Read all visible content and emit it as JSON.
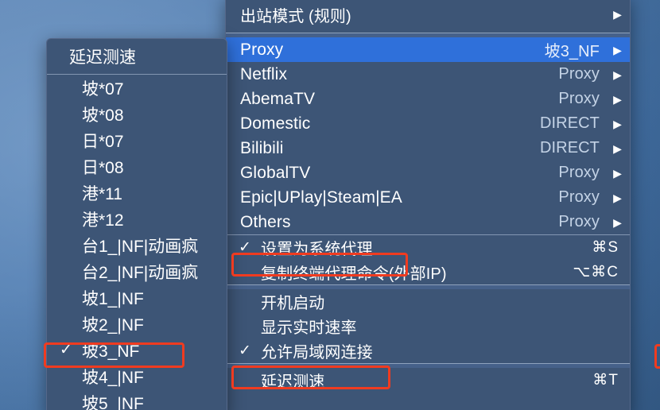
{
  "app": {
    "kind": "macos-menubar-dropdown",
    "accent_selected": "#2f70da",
    "menu_background": "#3d5576",
    "annotation_color": "#f03b20"
  },
  "main_menu": {
    "header": {
      "label": "出站模式 (规则)",
      "arrow": "▶"
    },
    "proxy_groups": [
      {
        "label": "Proxy",
        "value": "坡3_NF",
        "arrow": "▶",
        "selected": true
      },
      {
        "label": "Netflix",
        "value": "Proxy",
        "arrow": "▶",
        "selected": false
      },
      {
        "label": "AbemaTV",
        "value": "Proxy",
        "arrow": "▶",
        "selected": false
      },
      {
        "label": "Domestic",
        "value": "DIRECT",
        "arrow": "▶",
        "selected": false
      },
      {
        "label": "Bilibili",
        "value": "DIRECT",
        "arrow": "▶",
        "selected": false
      },
      {
        "label": "GlobalTV",
        "value": "Proxy",
        "arrow": "▶",
        "selected": false
      },
      {
        "label": "Epic|UPlay|Steam|EA",
        "value": "Proxy",
        "arrow": "▶",
        "selected": false
      },
      {
        "label": "Others",
        "value": "Proxy",
        "arrow": "▶",
        "selected": false
      }
    ],
    "system_items": [
      {
        "label": "设置为系统代理",
        "shortcut": "⌘S",
        "checked": true,
        "check": "✓",
        "annotated": true
      },
      {
        "label": "复制终端代理命令(外部IP)",
        "shortcut": "⌥⌘C",
        "checked": false,
        "check": "",
        "annotated": false
      }
    ],
    "option_items": [
      {
        "label": "开机启动",
        "shortcut": "",
        "checked": false,
        "check": "",
        "annotated": false
      },
      {
        "label": "显示实时速率",
        "shortcut": "",
        "checked": false,
        "check": "",
        "annotated": false
      },
      {
        "label": "允许局域网连接",
        "shortcut": "",
        "checked": true,
        "check": "✓",
        "annotated": true
      }
    ],
    "footer_items": [
      {
        "label": "延迟测速",
        "shortcut": "⌘T",
        "checked": false,
        "check": "",
        "annotated": false
      }
    ]
  },
  "sub_menu": {
    "title": "延迟测速",
    "items": [
      {
        "label": "坡*07",
        "checked": false,
        "check": "",
        "annotated": false
      },
      {
        "label": "坡*08",
        "checked": false,
        "check": "",
        "annotated": false
      },
      {
        "label": "日*07",
        "checked": false,
        "check": "",
        "annotated": false
      },
      {
        "label": "日*08",
        "checked": false,
        "check": "",
        "annotated": false
      },
      {
        "label": "港*11",
        "checked": false,
        "check": "",
        "annotated": false
      },
      {
        "label": "港*12",
        "checked": false,
        "check": "",
        "annotated": false
      },
      {
        "label": "台1_|NF|动画疯",
        "checked": false,
        "check": "",
        "annotated": false
      },
      {
        "label": "台2_|NF|动画疯",
        "checked": false,
        "check": "",
        "annotated": false
      },
      {
        "label": "坡1_|NF",
        "checked": false,
        "check": "",
        "annotated": false
      },
      {
        "label": "坡2_|NF",
        "checked": false,
        "check": "",
        "annotated": false
      },
      {
        "label": "坡3_NF",
        "checked": true,
        "check": "✓",
        "annotated": true
      },
      {
        "label": "坡4_|NF",
        "checked": false,
        "check": "",
        "annotated": false
      },
      {
        "label": "坡5_|NF",
        "checked": false,
        "check": "",
        "annotated": false
      }
    ]
  }
}
